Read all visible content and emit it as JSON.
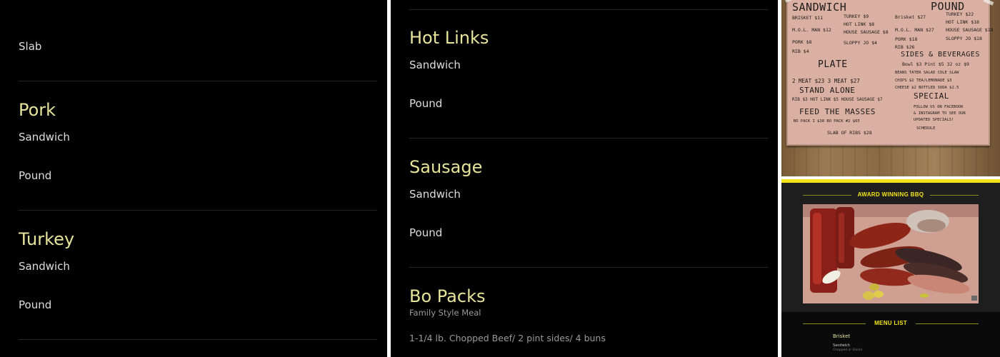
{
  "left_panel": {
    "slab_item": "Slab",
    "sections": [
      {
        "title": "Pork",
        "items": [
          "Sandwich",
          "Pound"
        ]
      },
      {
        "title": "Turkey",
        "items": [
          "Sandwich",
          "Pound"
        ]
      }
    ]
  },
  "middle_panel": {
    "sections": [
      {
        "title": "Hot Links",
        "items": [
          "Sandwich",
          "Pound"
        ]
      },
      {
        "title": "Sausage",
        "items": [
          "Sandwich",
          "Pound"
        ]
      },
      {
        "title": "Bo Packs",
        "subtitle": "Family Style Meal",
        "description": "1-1/4 lb. Chopped Beef/ 2 pint sides/ 4 buns"
      }
    ]
  },
  "board": {
    "sandwich_head": "SANDWICH",
    "pound_head": "POUND",
    "sw_brisket": "BRISKET $11",
    "sw_turkey": "TURKEY $9",
    "sw_molman": "M.O.L. MAN $12",
    "sw_hotlink": "HOT LINK $8",
    "sw_house": "HOUSE SAUSAGE $8",
    "sw_pork": "PORK $8",
    "sw_sloppy": "SLOPPY JO $4",
    "sw_rib": "RIB $4",
    "lb_brisket": "Brisket $27",
    "lb_turkey": "TURKEY $22",
    "lb_molman": "M.O.L. MAN $27",
    "lb_hotlink": "HOT LINK $18",
    "lb_pork": "PORK $18",
    "lb_house": "HOUSE SAUSAGE $18",
    "lb_rib": "RIB $26",
    "lb_sloppy": "SLOPPY JO $18",
    "plate_head": "PLATE",
    "sides_head": "SIDES & BEVERAGES",
    "plate_line": "2 MEAT $23  3 MEAT $27",
    "sides_line1": "Bowl $3  Pint $5  32 oz $9",
    "sides_line2": "BEANS  TATER SALAD  COLE SLAW",
    "standalone_head": "STAND ALONE",
    "standalone_line": "RIB $3  HOT LINK $5  HOUSE SAUSAGE $7",
    "sides_line3": "CHIPS $2   TEA/LEMONADE $3",
    "sides_line4": "CHEESE $2   BOTTLED SODA $2.5",
    "special_head": "SPECIAL",
    "feed_head": "FEED THE MASSES",
    "feed_line": "BO PACK I $38   BO PACK #2 $65",
    "special_line1": "FOLLOW US ON FACEBOOK",
    "special_line2": "& INSTAGRAM TO SEE OUR",
    "special_line3": "UPDATED SPECIALS!",
    "special_line4": "SCHEDULE",
    "slab_line": "SLAB OF RIBS $28"
  },
  "site": {
    "award_heading": "AWARD WINNING BBQ",
    "menu_heading": "MENU LIST",
    "first_item": "Brisket",
    "first_sub": "Sandwich",
    "first_sub2": "Chopped or Sliced"
  },
  "colors": {
    "background": "#000000",
    "category": "#e6e39b",
    "item": "#dedede",
    "muted": "#9a9a9a",
    "site_accent": "#f3e31b"
  }
}
